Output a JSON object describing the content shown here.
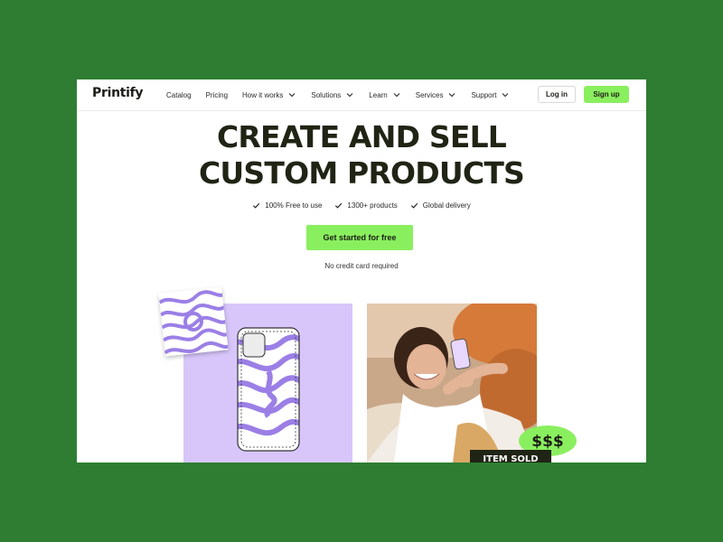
{
  "brand": {
    "logo": "Printify"
  },
  "nav": {
    "links": [
      {
        "label": "Catalog",
        "has_dropdown": false
      },
      {
        "label": "Pricing",
        "has_dropdown": false
      },
      {
        "label": "How it works",
        "has_dropdown": true
      },
      {
        "label": "Solutions",
        "has_dropdown": true
      },
      {
        "label": "Learn",
        "has_dropdown": true
      },
      {
        "label": "Services",
        "has_dropdown": true
      },
      {
        "label": "Support",
        "has_dropdown": true
      }
    ],
    "login_label": "Log in",
    "signup_label": "Sign up"
  },
  "hero": {
    "headline_line1": "CREATE AND SELL",
    "headline_line2": "CUSTOM PRODUCTS",
    "features": [
      "100% Free to use",
      "1300+ products",
      "Global delivery"
    ],
    "cta_label": "Get started for free",
    "subnote": "No credit card required"
  },
  "media": {
    "sticker_text": "$$$",
    "sold_badge_text": "ITEM SOLD"
  },
  "colors": {
    "outer_background": "#2e7d32",
    "accent_green": "#8aef5f",
    "lilac_panel": "#d8c6fb",
    "swirl_purple": "#9b7fe6",
    "headline_text": "#1f2414"
  },
  "icons": [
    "chevron-down-icon",
    "check-icon"
  ]
}
